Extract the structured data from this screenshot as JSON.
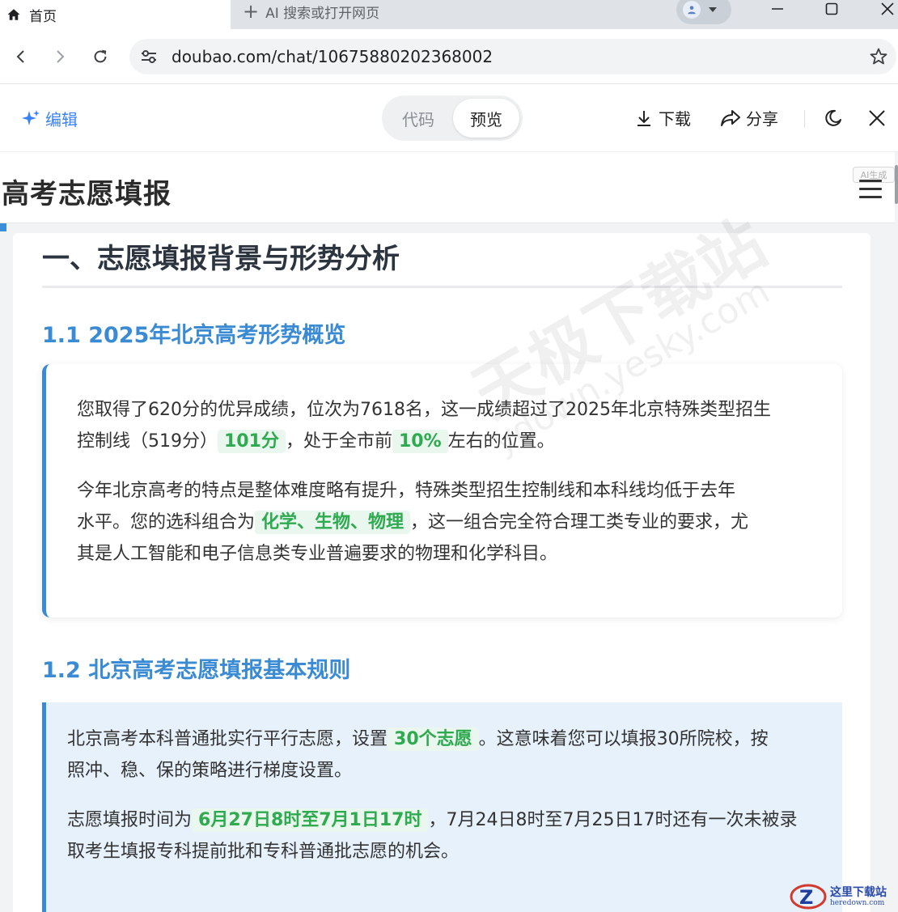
{
  "browser": {
    "active_tab_title": "首页",
    "new_tab_label": "AI 搜索或打开网页",
    "url": "doubao.com/chat/10675880202368002"
  },
  "app_header": {
    "edit_label": "编辑",
    "toggle_code": "代码",
    "toggle_preview": "预览",
    "download_label": "下载",
    "share_label": "分享"
  },
  "site": {
    "title": "高考志愿填报",
    "ai_badge": "AI生成"
  },
  "content": {
    "section_title": "一、志愿填报背景与形势分析",
    "sub1_title": "1.1 2025年北京高考形势概览",
    "card1": {
      "p1_line1": "您取得了620分的优异成绩，位次为7618名，这一成绩超过了2025年北京特殊类型招生",
      "p1_line2_pre": "控制线（519分）",
      "p1_hl1": "101分",
      "p1_line2_mid": "，处于全市前",
      "p1_hl2": "10%",
      "p1_line2_post": "左右的位置。",
      "p2_line1": "今年北京高考的特点是整体难度略有提升，特殊类型招生控制线和本科线均低于去年",
      "p2_line2_pre": "水平。您的选科组合为",
      "p2_hl": "化学、生物、物理",
      "p2_line2_post": "，这一组合完全符合理工类专业的要求，尤",
      "p2_line3": "其是人工智能和电子信息类专业普遍要求的物理和化学科目。"
    },
    "sub2_title": "1.2 北京高考志愿填报基本规则",
    "card2": {
      "p1_line1_pre": "北京高考本科普通批实行平行志愿，设置",
      "p1_hl": "30个志愿",
      "p1_line1_post": "。这意味着您可以填报30所院校，按",
      "p1_line2": "照冲、稳、保的策略进行梯度设置。",
      "p2_line1_pre": "志愿填报时间为",
      "p2_hl": "6月27日8时至7月1日17时",
      "p2_line1_post": "，7月24日8时至7月25日17时还有一次未被录",
      "p2_line2": "取考生填报专科提前批和专科普通批志愿的机会。"
    }
  },
  "watermark": {
    "cn": "天极下载站",
    "en": "ydown.yesky.com"
  },
  "corner_logo": {
    "cn": "这里下载站",
    "en": "heredown.com"
  },
  "colors": {
    "accent": "#3a8bd4",
    "highlight_text": "#2eaa4f",
    "highlight_bg": "#e9f7ef",
    "card2_bg": "#e6f1fb"
  }
}
